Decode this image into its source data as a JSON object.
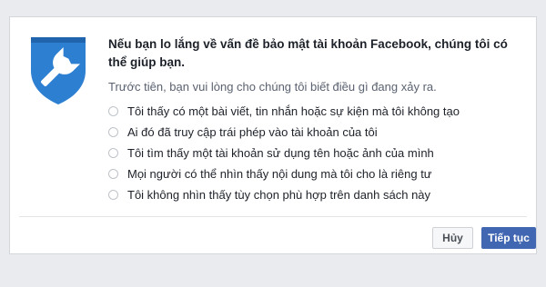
{
  "dialog": {
    "heading": "Nếu bạn lo lắng về vấn đề bảo mật tài khoản Facebook, chúng tôi có thể giúp bạn.",
    "subtitle": "Trước tiên, bạn vui lòng cho chúng tôi biết điều gì đang xảy ra.",
    "icon": "shield-wrench-icon",
    "options": [
      {
        "label": "Tôi thấy có một bài viết, tin nhắn hoặc sự kiện mà tôi không tạo"
      },
      {
        "label": "Ai đó đã truy cập trái phép vào tài khoản của tôi"
      },
      {
        "label": "Tôi tìm thấy một tài khoản sử dụng tên hoặc ảnh của mình"
      },
      {
        "label": "Mọi người có thể nhìn thấy nội dung mà tôi cho là riêng tư"
      },
      {
        "label": "Tôi không nhìn thấy tùy chọn phù hợp trên danh sách này"
      }
    ],
    "buttons": {
      "cancel": "Hủy",
      "continue": "Tiếp tục"
    }
  },
  "colors": {
    "background": "#e9ebee",
    "shield_blue": "#2d7fd2",
    "primary_button": "#4267b2",
    "text": "#1d2129"
  }
}
